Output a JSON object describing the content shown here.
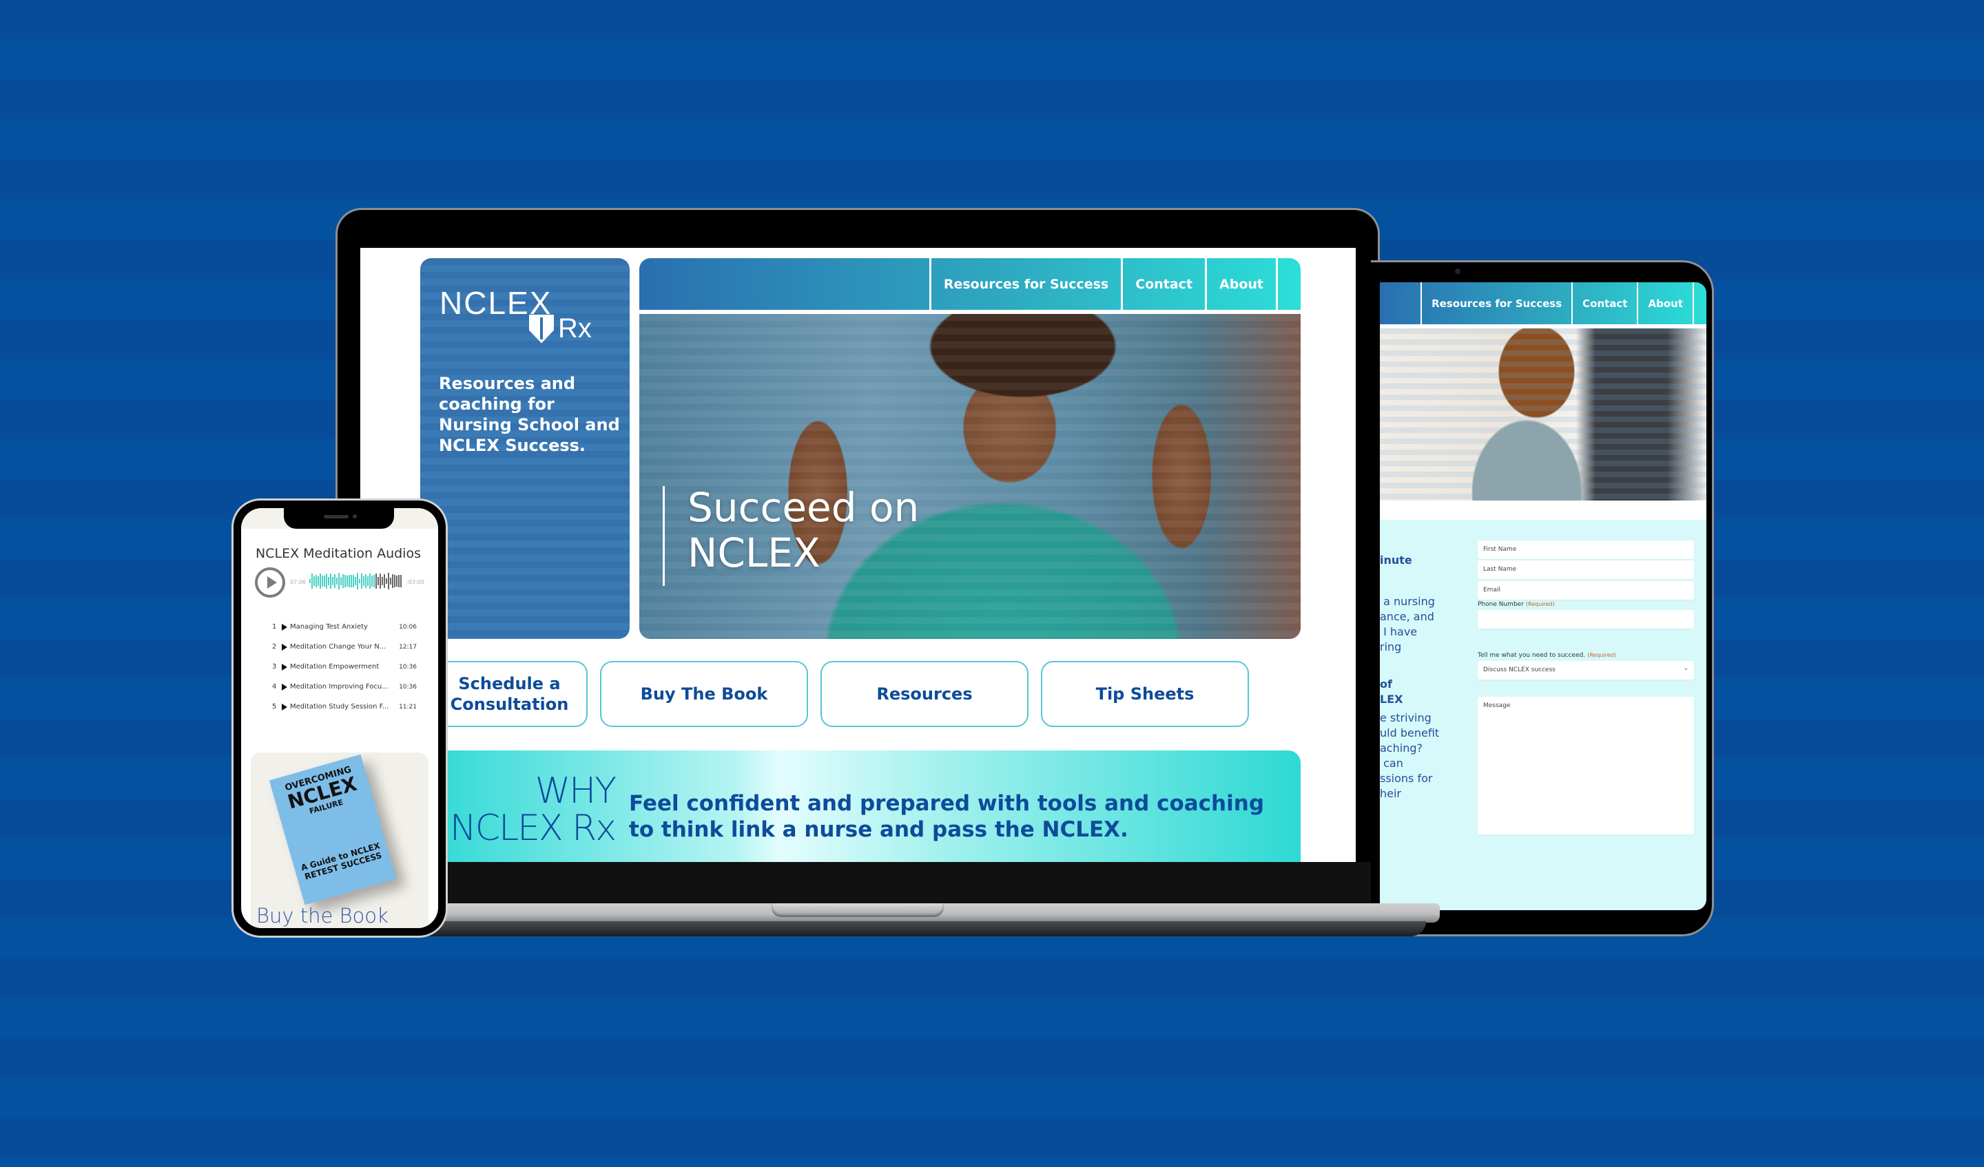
{
  "colors": {
    "background_dark": "#064C98",
    "background_light": "#0451A0",
    "brand_blue": "#0D4B9B",
    "teal": "#2CDED8",
    "required": "#C2632F"
  },
  "laptop": {
    "logo": {
      "word": "NCLEX",
      "suffix": "Rx",
      "emblem": "caduceus-shield-icon"
    },
    "tagline": "Resources and coaching for Nursing School and NCLEX Success.",
    "nav": [
      {
        "label": "Resources for Success"
      },
      {
        "label": "Contact"
      },
      {
        "label": "About"
      }
    ],
    "hero": {
      "headline": "Succeed on NCLEX",
      "image": "nurse-flexing-arms-photo"
    },
    "ctas": [
      {
        "label": "Schedule a Consultation"
      },
      {
        "label": "Buy The Book"
      },
      {
        "label": "Resources"
      },
      {
        "label": "Tip Sheets"
      }
    ],
    "why": {
      "title_line1": "WHY",
      "title_line2": "NCLEX Rx",
      "text": "Feel confident and prepared with tools and coaching to think link a nurse and pass the NCLEX."
    }
  },
  "tablet": {
    "nav": [
      {
        "label": "Resources for Success"
      },
      {
        "label": "Contact"
      },
      {
        "label": "About"
      }
    ],
    "hero": {
      "image": "woman-writing-calendar-photo"
    },
    "left_text_fragments": [
      {
        "text": "inute",
        "bold": true
      },
      {
        "text": " a nursing\nance, and\n I have\nring",
        "bold": false
      },
      {
        "text": "of\nLEX",
        "bold": true
      },
      {
        "text": "e striving\nuld benefit\naching?\n can\nssions for\nheir",
        "bold": false
      }
    ],
    "form": {
      "first_name_placeholder": "First Name",
      "last_name_placeholder": "Last Name",
      "email_placeholder": "Email",
      "phone_label": "Phone Number",
      "phone_required": "(Required)",
      "phone_value": "",
      "need_label": "Tell me what you need to succeed.",
      "need_required": "(Required)",
      "need_selected": "Discuss NCLEX success",
      "message_placeholder": "Message"
    }
  },
  "phone": {
    "title": "NCLEX Meditation Audios",
    "player": {
      "elapsed": "07:06",
      "remaining": "-03:00",
      "progress": 0.7
    },
    "tracks": [
      {
        "num": "1",
        "name": "Managing Test Anxiety",
        "duration": "10:06"
      },
      {
        "num": "2",
        "name": "Meditation Change Your N...",
        "duration": "12:17"
      },
      {
        "num": "3",
        "name": "Meditation Empowerment",
        "duration": "10:36"
      },
      {
        "num": "4",
        "name": "Meditation Improving Focu...",
        "duration": "10:36"
      },
      {
        "num": "5",
        "name": "Meditation Study Session F...",
        "duration": "11:21"
      }
    ],
    "book": {
      "line1": "OVERCOMING",
      "line2": "NCLEX",
      "line3": "FAILURE",
      "subtitle": "A Guide to NCLEX RETEST SUCCESS"
    },
    "buy_label": "Buy the Book"
  }
}
